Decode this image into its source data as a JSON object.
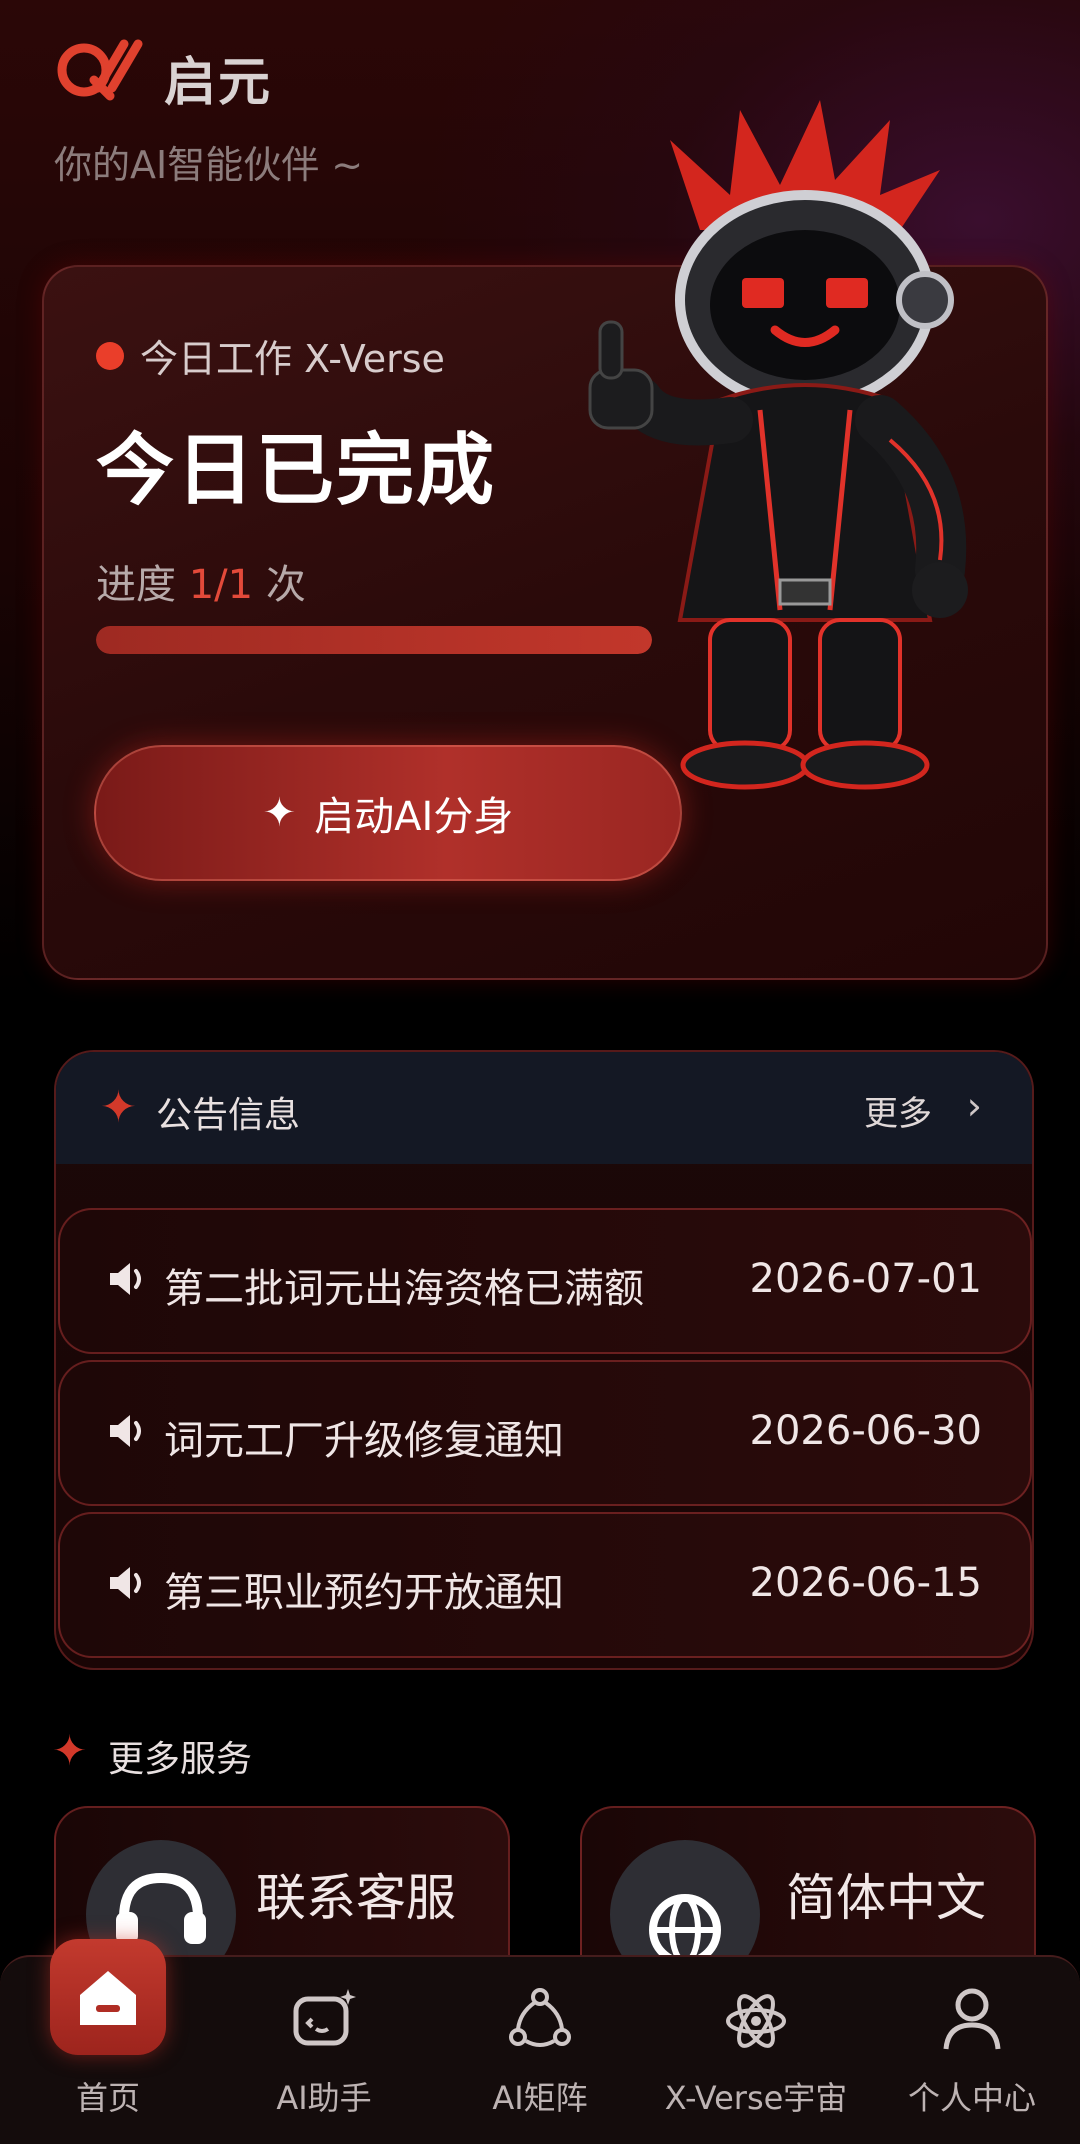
{
  "header": {
    "app_name": "启元",
    "slogan": "你的AI智能伙伴 ~"
  },
  "hero": {
    "tag": "今日工作 X-Verse",
    "title": "今日已完成",
    "progress_prefix": "进度",
    "progress_value": "1/1",
    "progress_suffix": "次",
    "progress_fraction": 1.0,
    "launch_label": "启动AI分身"
  },
  "announcements": {
    "title": "公告信息",
    "more_label": "更多",
    "items": [
      {
        "text": "第二批词元出海资格已满额",
        "date": "2026-07-01"
      },
      {
        "text": "词元工厂升级修复通知",
        "date": "2026-06-30"
      },
      {
        "text": "第三职业预约开放通知",
        "date": "2026-06-15"
      }
    ]
  },
  "services": {
    "title": "更多服务",
    "items": [
      {
        "label": "联系客服",
        "icon": "headset-icon"
      },
      {
        "label": "简体中文",
        "icon": "globe-icon"
      }
    ]
  },
  "tabbar": {
    "items": [
      {
        "label": "首页",
        "icon": "home-icon",
        "active": true
      },
      {
        "label": "AI助手",
        "icon": "ai-assistant-icon",
        "active": false
      },
      {
        "label": "AI矩阵",
        "icon": "network-icon",
        "active": false
      },
      {
        "label": "X-Verse宇宙",
        "icon": "atom-icon",
        "active": false
      },
      {
        "label": "个人中心",
        "icon": "user-icon",
        "active": false
      }
    ]
  },
  "colors": {
    "accent": "#e34a3a",
    "background": "#000000",
    "card": "#2a0a0a"
  }
}
